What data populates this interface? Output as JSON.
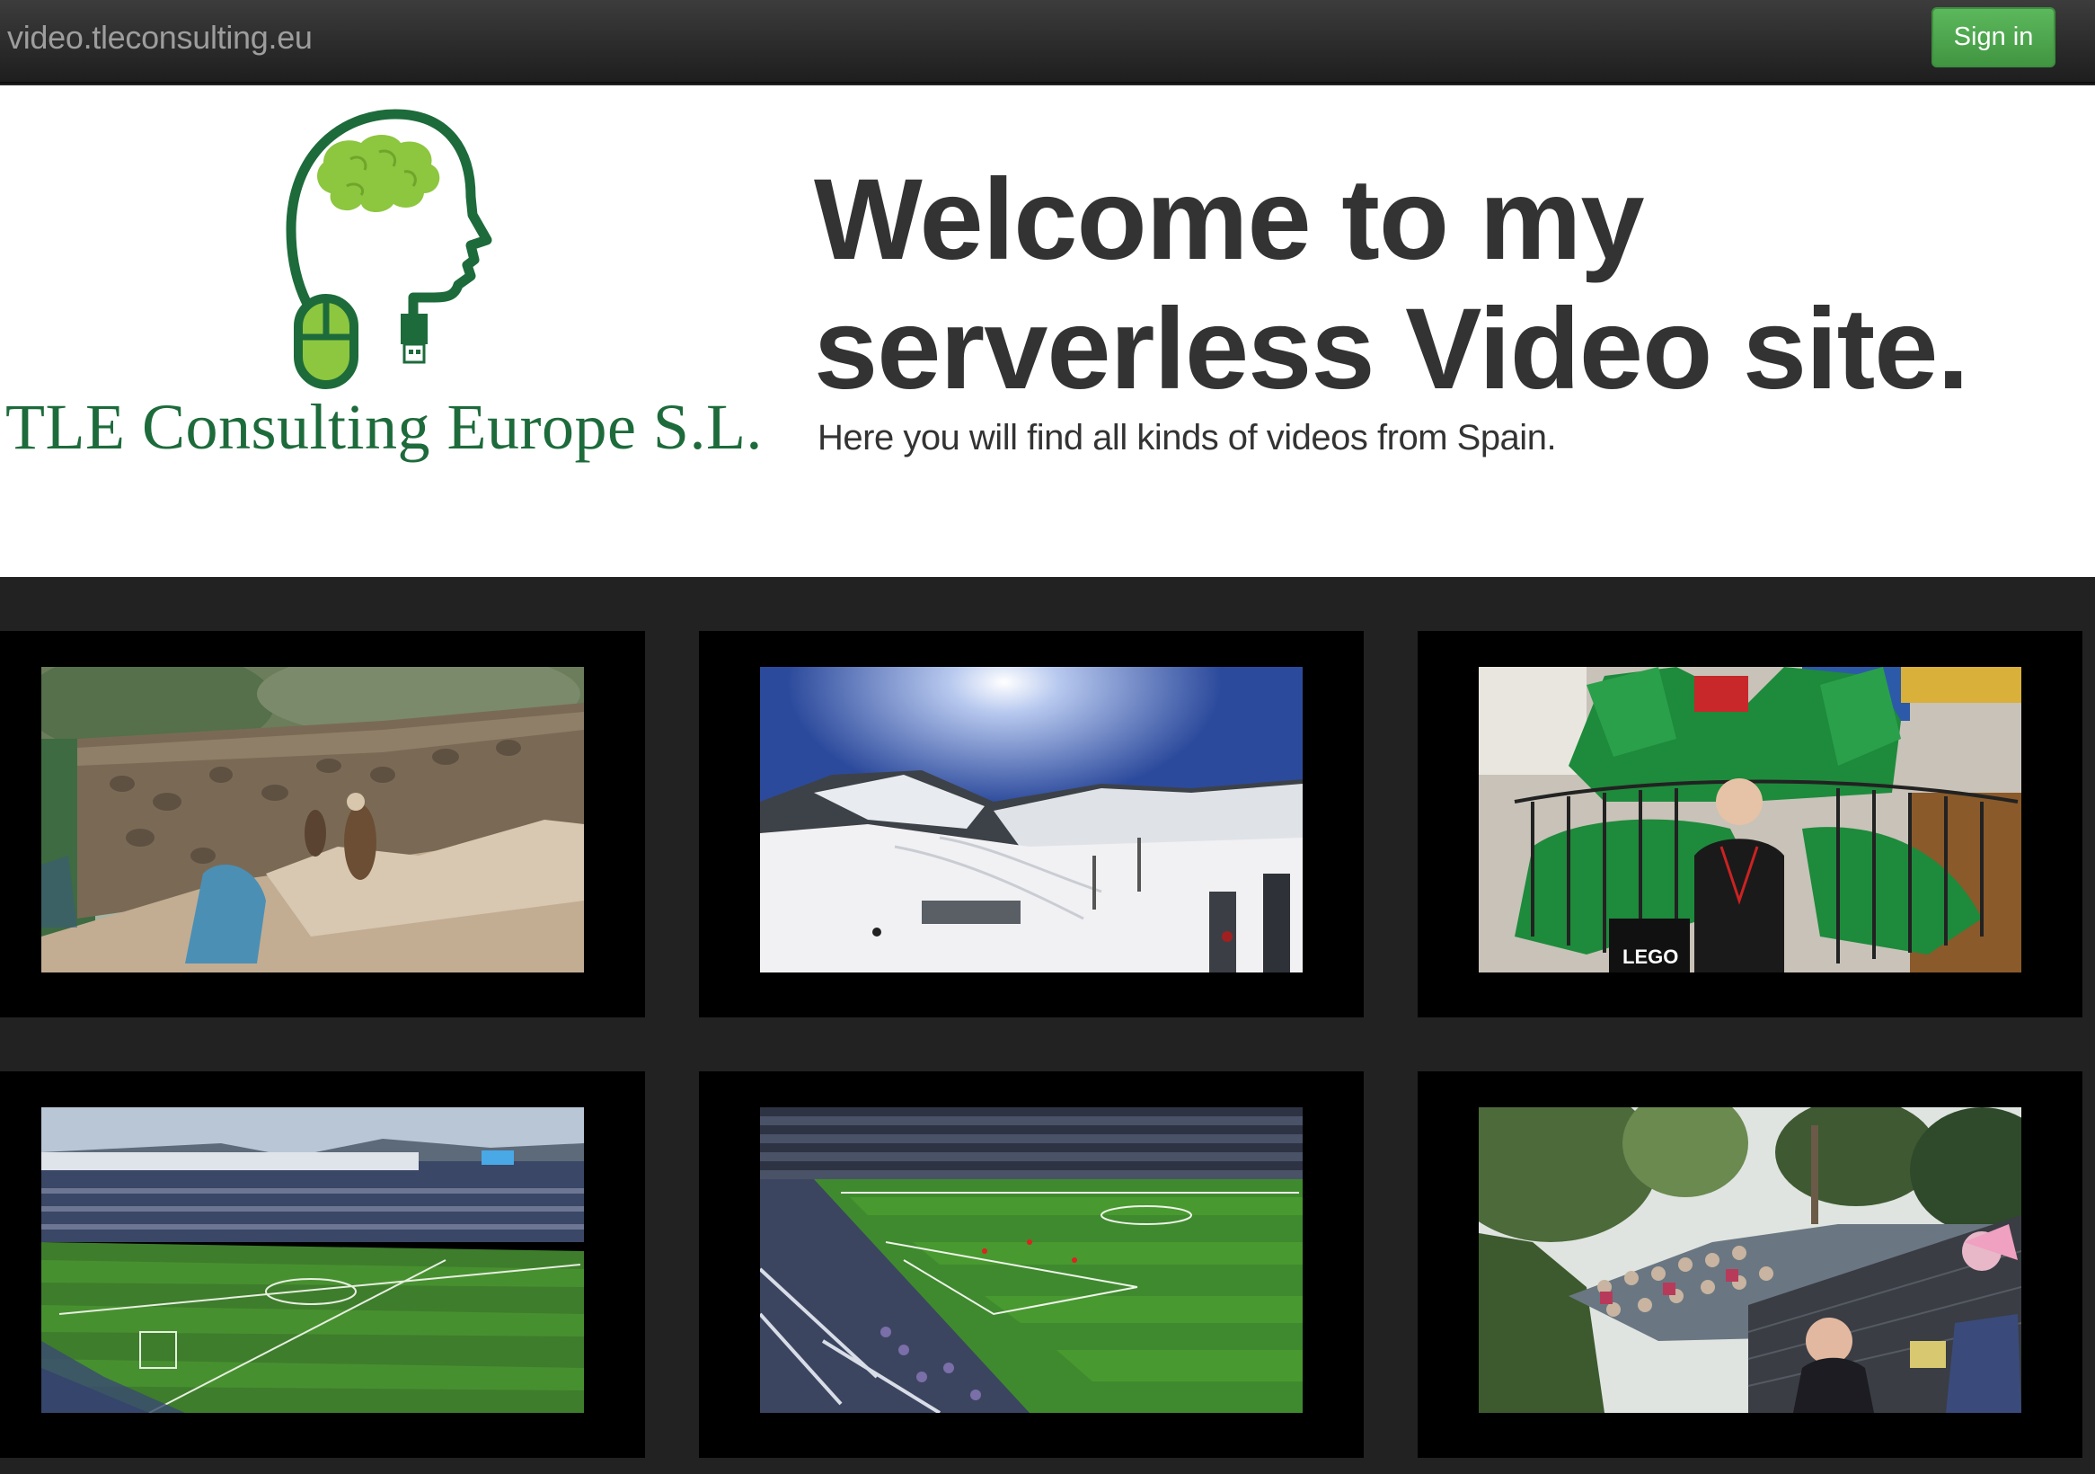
{
  "navbar": {
    "brand": "video.tleconsulting.eu",
    "signin_label": "Sign in"
  },
  "hero": {
    "company_name": "TLE Consulting Europe S.L.",
    "title_line1": "Welcome to my",
    "title_line2": "serverless Video site.",
    "subtitle": "Here you will find all kinds of videos from Spain."
  },
  "videos": [
    {
      "scene": "vultures-aviary"
    },
    {
      "scene": "ski-slopes"
    },
    {
      "scene": "lego-dragon"
    },
    {
      "scene": "football-stadium-day"
    },
    {
      "scene": "football-stadium-night"
    },
    {
      "scene": "bird-show-crowd"
    }
  ],
  "colors": {
    "accent_green": "#5cb85c",
    "logo_green": "#1d6b3b",
    "brain_green": "#8dc63f",
    "grid_bg": "#222222"
  }
}
